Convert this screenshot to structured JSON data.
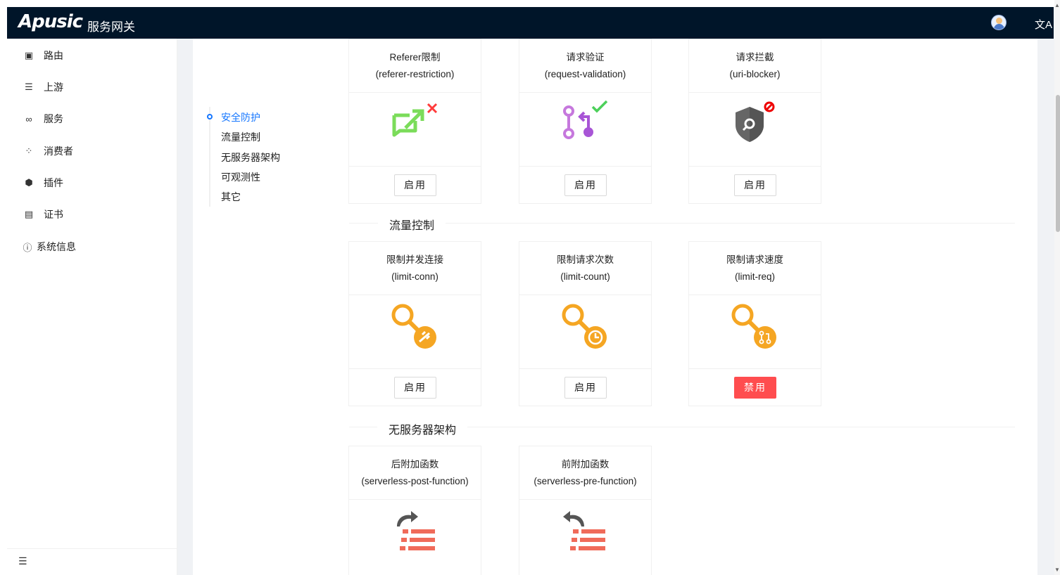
{
  "header": {
    "logo": "Apusic",
    "title": "服务网关",
    "lang_icon": "文A"
  },
  "sidebar": {
    "items": [
      {
        "label": "路由",
        "icon": "route-icon"
      },
      {
        "label": "上游",
        "icon": "server-icon"
      },
      {
        "label": "服务",
        "icon": "service-icon"
      },
      {
        "label": "消费者",
        "icon": "consumer-icon"
      },
      {
        "label": "插件",
        "icon": "plugin-icon"
      },
      {
        "label": "证书",
        "icon": "certificate-icon"
      },
      {
        "label": "系统信息",
        "icon": "info-icon"
      }
    ],
    "collapse_icon": "menu-fold-icon"
  },
  "anchor": {
    "links": [
      "安全防护",
      "流量控制",
      "无服务器架构",
      "可观测性",
      "其它"
    ],
    "active": "安全防护"
  },
  "sections": {
    "security": {
      "cards": [
        {
          "name": "Referer限制",
          "id": "(referer-restriction)",
          "button": "启用",
          "icon": "referer-restriction-icon"
        },
        {
          "name": "请求验证",
          "id": "(request-validation)",
          "button": "启用",
          "icon": "request-validation-icon"
        },
        {
          "name": "请求拦截",
          "id": "(uri-blocker)",
          "button": "启用",
          "icon": "uri-blocker-icon"
        }
      ]
    },
    "traffic": {
      "title": "流量控制",
      "cards": [
        {
          "name": "限制并发连接",
          "id": "(limit-conn)",
          "button": "启用",
          "icon": "limit-conn-icon"
        },
        {
          "name": "限制请求次数",
          "id": "(limit-count)",
          "button": "启用",
          "icon": "limit-count-icon"
        },
        {
          "name": "限制请求速度",
          "id": "(limit-req)",
          "button": "禁用",
          "icon": "limit-req-icon"
        }
      ]
    },
    "serverless": {
      "title": "无服务器架构",
      "cards": [
        {
          "name": "后附加函数",
          "id": "(serverless-post-function)",
          "icon": "serverless-post-function-icon"
        },
        {
          "name": "前附加函数",
          "id": "(serverless-pre-function)",
          "icon": "serverless-pre-function-icon"
        }
      ]
    }
  },
  "colors": {
    "header_bg": "#001529",
    "primary": "#1677ff",
    "danger": "#ff4d4f",
    "orange": "#f5a623"
  }
}
